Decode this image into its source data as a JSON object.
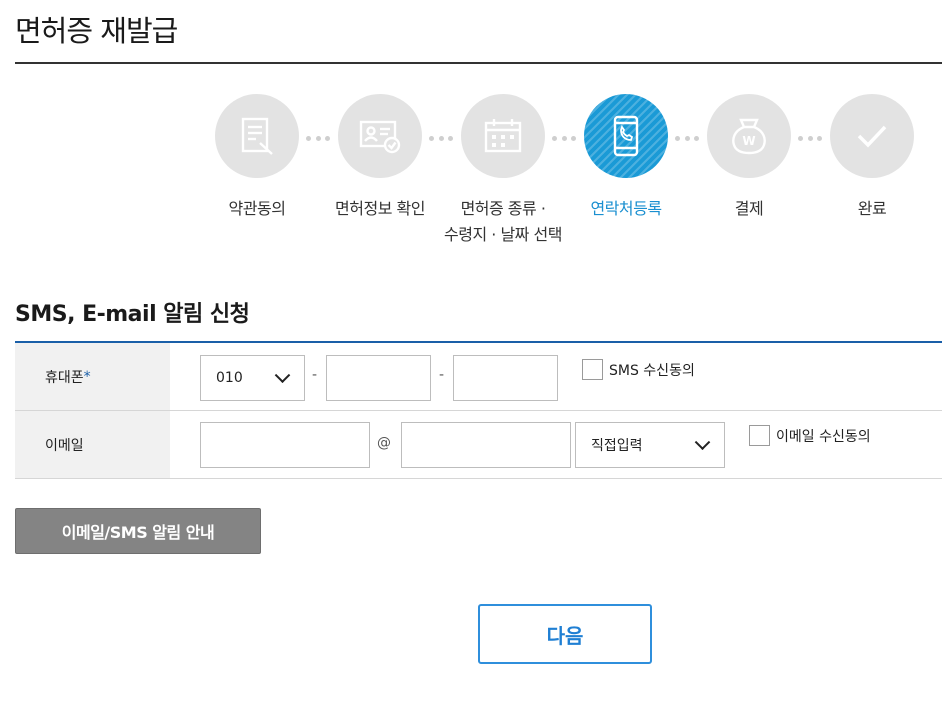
{
  "page": {
    "title": "면허증 재발급"
  },
  "steps": [
    {
      "label": "약관동의",
      "icon": "document-edit-icon",
      "active": false
    },
    {
      "label": "면허정보 확인",
      "icon": "id-card-check-icon",
      "active": false
    },
    {
      "label": "면허증 종류 ·\n수령지 · 날짜 선택",
      "icon": "calendar-icon",
      "active": false
    },
    {
      "label": "연락처등록",
      "icon": "phone-icon",
      "active": true
    },
    {
      "label": "결제",
      "icon": "money-bag-icon",
      "active": false
    },
    {
      "label": "완료",
      "icon": "checkmark-icon",
      "active": false
    }
  ],
  "section": {
    "title": "SMS, E-mail 알림 신청"
  },
  "form": {
    "phone": {
      "label": "휴대폰",
      "required_mark": "*",
      "prefix_value": "010",
      "separator": "-",
      "middle_value": "",
      "last_value": "",
      "consent_label": "SMS 수신동의"
    },
    "email": {
      "label": "이메일",
      "local_value": "",
      "at": "@",
      "domain_value": "",
      "domain_select": "직접입력",
      "consent_label": "이메일 수신동의"
    }
  },
  "buttons": {
    "notice": "이메일/SMS 알림 안내",
    "next": "다음"
  },
  "colors": {
    "accent": "#1a9ad6",
    "table_border": "#1a5fa8",
    "next_border": "#2f8fdc",
    "notice_bg": "#848484"
  }
}
